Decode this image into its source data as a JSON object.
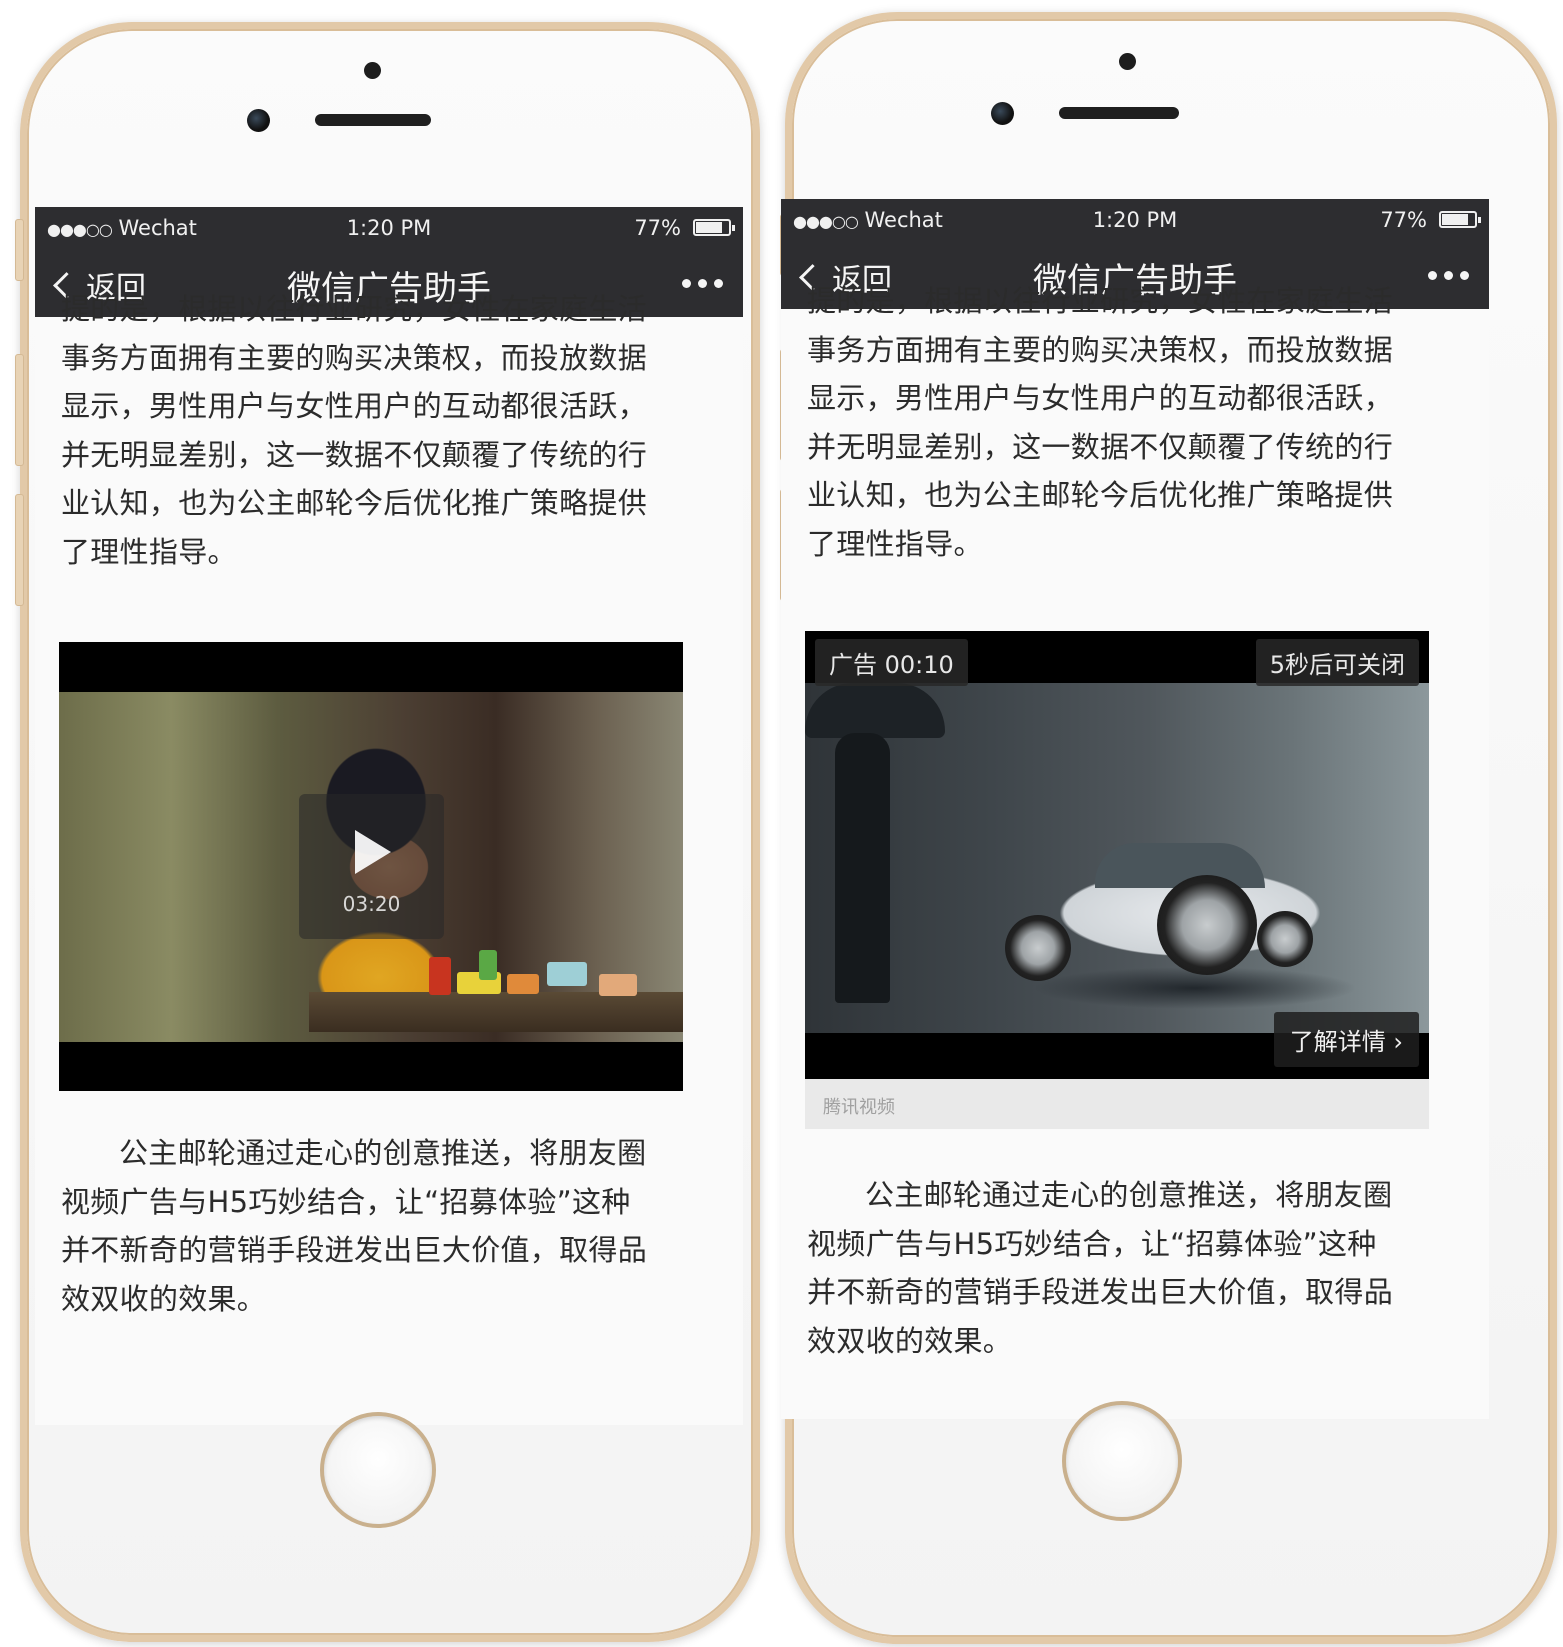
{
  "status_bar": {
    "signal": "●●●○○",
    "carrier": "Wechat",
    "time": "1:20 PM",
    "battery": "77%",
    "battery_level": 0.77
  },
  "nav": {
    "back_label": "返回",
    "title": "微信广告助手"
  },
  "article": {
    "intro_lines": [
      "提的是，根据以往行业研究，女性在家庭生活",
      "事务方面拥有主要的购买决策权，而投放数据",
      "显示，男性用户与女性用户的互动都很活跃，",
      "并无明显差别，这一数据不仅颠覆了传统的行",
      "业认知，也为公主邮轮今后优化推广策略提供",
      "了理性指导。"
    ],
    "conclusion_lines": [
      "公主邮轮通过走心的创意推送，将朋友圈",
      "视频广告与H5巧妙结合，让“招募体验”这种",
      "并不新奇的营销手段迸发出巨大价值，取得品",
      "效双收的效果。"
    ]
  },
  "left_video": {
    "duration": "03:20"
  },
  "right_video": {
    "ad_label": "广告 00:10",
    "close_hint": "5秒后可关闭",
    "detail_label": "了解详情",
    "source": "腾讯视频"
  }
}
